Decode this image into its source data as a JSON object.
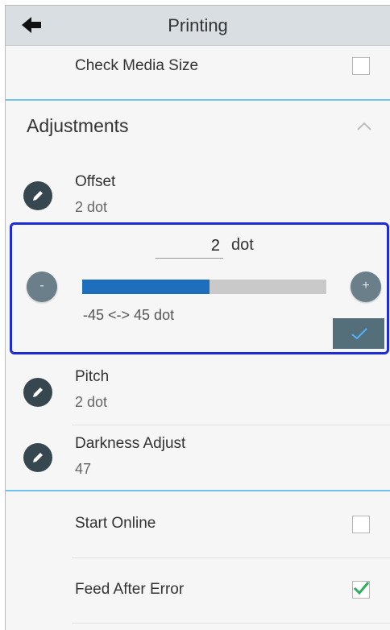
{
  "header": {
    "title": "Printing",
    "back_icon": "arrow-left-icon"
  },
  "check_media_size": {
    "label": "Check Media Size",
    "checked": false
  },
  "adjustments": {
    "title": "Adjustments",
    "collapse_icon": "chevron-up-icon",
    "offset": {
      "label": "Offset",
      "value": "2 dot"
    },
    "editor": {
      "value": "2",
      "unit": "dot",
      "minus_label": "-",
      "plus_label": "+",
      "range_text": "-45 <-> 45 dot",
      "min": -45,
      "max": 45,
      "current": 2,
      "fill_fraction": 0.52
    },
    "pitch": {
      "label": "Pitch",
      "value": "2 dot"
    },
    "darkness": {
      "label": "Darkness Adjust",
      "value": "47"
    }
  },
  "start_online": {
    "label": "Start Online",
    "checked": false
  },
  "feed_after_error": {
    "label": "Feed After Error",
    "checked": true
  },
  "colors": {
    "accent_blue": "#1c2bd6",
    "slider_blue": "#1d6fbd",
    "divider_blue": "#6ec3ef",
    "check_green": "#2fae5d"
  }
}
